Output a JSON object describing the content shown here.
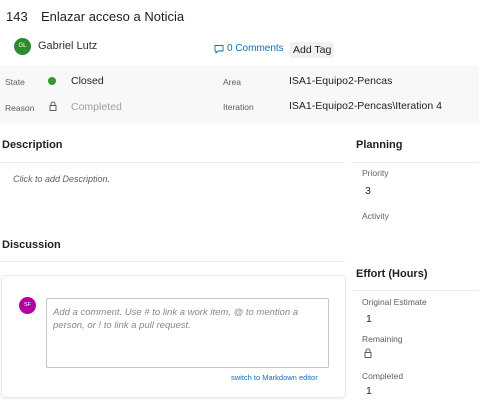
{
  "work_item": {
    "id": "143",
    "title": "Enlazar acceso a Noticia",
    "assignee_initials": "GL",
    "assignee": "Gabriel Lutz",
    "comments_link": "0 Comments",
    "add_tag": "Add Tag"
  },
  "fields": {
    "state_label": "State",
    "state_value": "Closed",
    "state_color": "#339933",
    "reason_label": "Reason",
    "reason_value": "Completed",
    "area_label": "Area",
    "area_value": "ISA1-Equipo2-Pencas",
    "iteration_label": "Iteration",
    "iteration_value": "ISA1-Equipo2-Pencas\\Iteration 4"
  },
  "description": {
    "title": "Description",
    "placeholder": "Click to add Description."
  },
  "discussion": {
    "title": "Discussion",
    "avatar_initials": "SF",
    "avatar_color": "#b4009e",
    "comment_placeholder": "Add a comment. Use # to link a work item, @ to mention a person, or ! to link a pull request.",
    "markdown_link": "switch to Markdown editor"
  },
  "planning": {
    "title": "Planning",
    "priority_label": "Priority",
    "priority_value": "3",
    "activity_label": "Activity"
  },
  "effort": {
    "title": "Effort (Hours)",
    "original_label": "Original Estimate",
    "original_value": "1",
    "remaining_label": "Remaining",
    "completed_label": "Completed",
    "completed_value": "1"
  },
  "icons": [
    "comment-icon",
    "lock-icon"
  ],
  "colors": {
    "link": "#106ebe",
    "assignee_avatar": "#2d8a2d"
  }
}
